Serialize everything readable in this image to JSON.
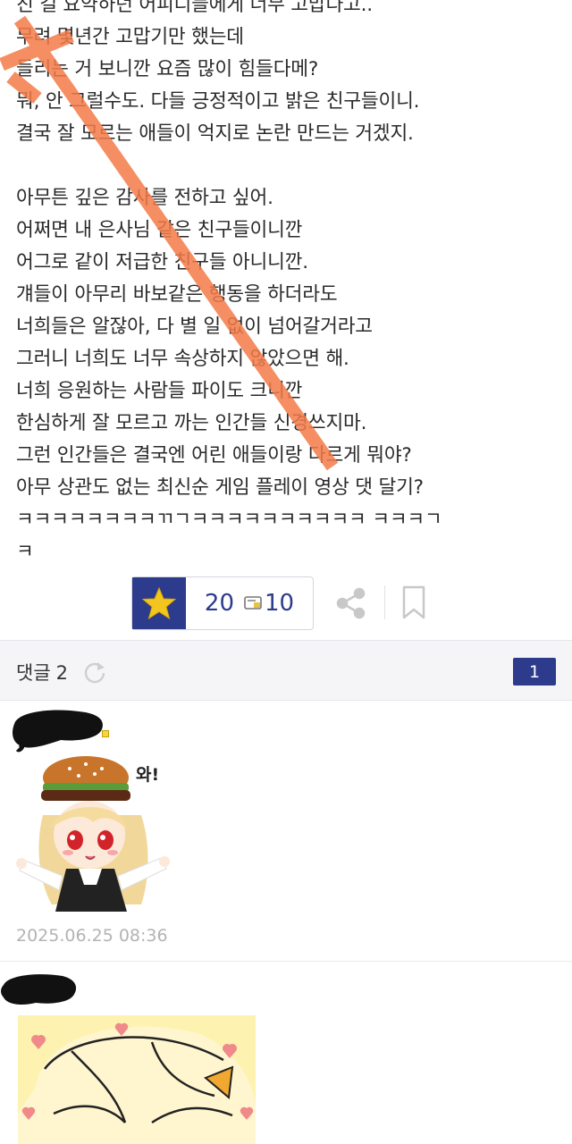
{
  "post": {
    "lines": [
      "친 걸 요약하던 어피디들에게 너무 고맙다고..",
      "무려 몇년간 고맙기만 했는데",
      "들리는 거 보니깐 요즘 많이 힘들다메?",
      "뭐, 안 그럴수도. 다들 긍정적이고 밝은 친구들이니.",
      "결국 잘 모르는 애들이 억지로 논란 만드는 거겠지.",
      "",
      "아무튼 깊은 감사를 전하고 싶어.",
      "어쩌면 내 은사님 같은 친구들이니깐",
      "어그로 같이 저급한 친구들 아니니깐.",
      "걔들이 아무리 바보같은 행동을 하더라도",
      "너희들은 알잖아, 다 별 일 없이 넘어갈거라고",
      "그러니 너희도 너무 속상하지 않았으면 해.",
      "너희 응원하는 사람들 파이도 크니깐",
      "한심하게 잘 모르고 까는 인간들 신경쓰지마.",
      "그런 인간들은 결국엔 어린 애들이랑 다르게 뭐야?",
      "아무 상관도 없는 최신순 게임 플레이 영상 댓 달기?",
      "ㅋㅋㅋㅋㅋㅋㅋㅋㄲㄱㅋㅋㅋㅋㅋㅋㅋㅋㅋㅋ ㅋㅋㅋㄱ",
      "ㅋ"
    ]
  },
  "actions": {
    "star_icon": "star-icon",
    "recommend_count": "20",
    "comment_icon": "comment-icon",
    "comment_count": "10",
    "share_icon": "share-icon",
    "bookmark_icon": "bookmark-icon"
  },
  "comments_header": {
    "label": "댓글",
    "total": "2",
    "refresh_icon": "refresh-icon",
    "page": "1"
  },
  "comments": [
    {
      "sticker_text": "와!",
      "timestamp": "2025.06.25 08:36"
    },
    {
      "sticker_text": "",
      "timestamp": ""
    }
  ],
  "colors": {
    "accent": "#2c3b8c",
    "star": "#f5c51f",
    "strike": "#f47b48",
    "muted": "#b3b3b3"
  }
}
